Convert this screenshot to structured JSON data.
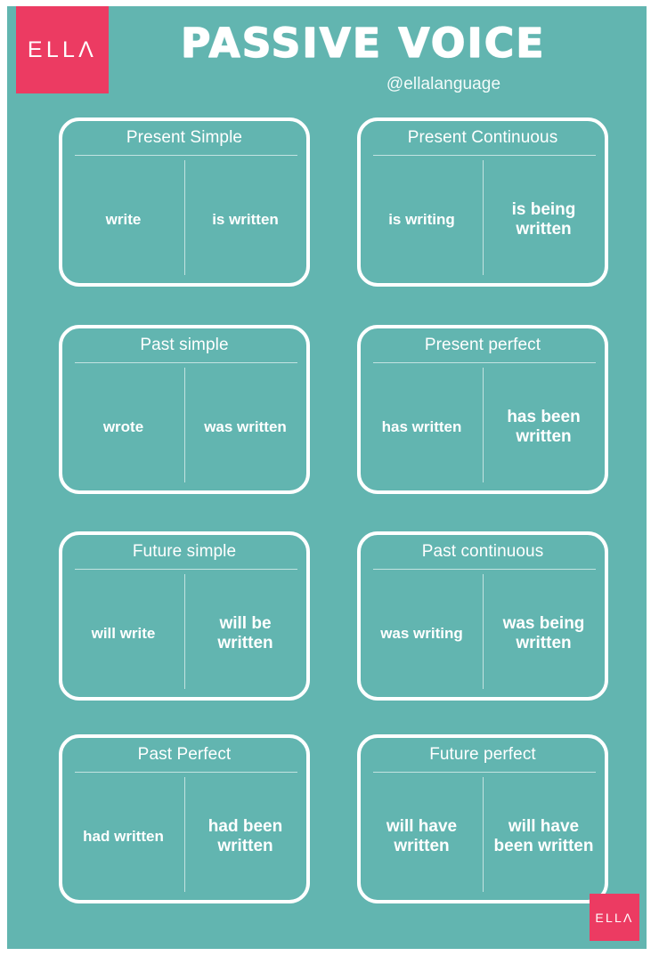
{
  "header": {
    "logo": {
      "prefix": "ELL",
      "chevron": "Λ",
      "full": "ELLΛ"
    },
    "title": "PASSIVE VOICE",
    "handle": "@ellalanguage"
  },
  "footer": {
    "logo": {
      "prefix": "ELL",
      "chevron": "Λ",
      "full": "ELLΛ"
    }
  },
  "colors": {
    "background_teal": "#62b5b0",
    "accent_pink": "#ec3b62",
    "text_white": "#ffffff",
    "page_white": "#ffffff"
  },
  "cards": [
    {
      "title": "Present Simple",
      "active": "write",
      "passive": "is written",
      "active_lines": 1,
      "passive_lines": 1
    },
    {
      "title": "Present Continuous",
      "active": "is writing",
      "passive": "is being\nwritten",
      "active_lines": 1,
      "passive_lines": 2
    },
    {
      "title": "Past simple",
      "active": "wrote",
      "passive": "was written",
      "active_lines": 1,
      "passive_lines": 1
    },
    {
      "title": "Present perfect",
      "active": "has written",
      "passive": "has been\nwritten",
      "active_lines": 1,
      "passive_lines": 2
    },
    {
      "title": "Future simple",
      "active": "will write",
      "passive": "will be\nwritten",
      "active_lines": 1,
      "passive_lines": 2
    },
    {
      "title": "Past continuous",
      "active": "was writing",
      "passive": "was being\nwritten",
      "active_lines": 1,
      "passive_lines": 2
    },
    {
      "title": "Past Perfect",
      "active": "had written",
      "passive": "had been\nwritten",
      "active_lines": 1,
      "passive_lines": 2
    },
    {
      "title": "Future perfect",
      "active": "will have\nwritten",
      "passive": "will have\nbeen written",
      "active_lines": 2,
      "passive_lines": 2
    }
  ]
}
